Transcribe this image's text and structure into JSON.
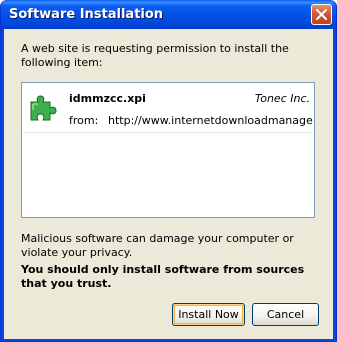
{
  "window": {
    "title": "Software Installation"
  },
  "dialog": {
    "intro_text": "A web site is requesting permission to install the following item:",
    "item": {
      "name": "idmmzcc.xpi",
      "author": "Tonec Inc.",
      "from_label": "from:",
      "from_url": "http://www.internetdownloadmanager.co",
      "icon": "puzzle-piece-icon"
    },
    "warning_text": "Malicious software can damage your computer or violate your privacy.",
    "advice_text": "You should only install software from sources that you trust.",
    "install_label": "Install Now",
    "cancel_label": "Cancel"
  },
  "colors": {
    "titlebar": "#0552e6",
    "client_background": "#ece9d8",
    "close_button": "#d2572e",
    "icon_green": "#3cb04a"
  }
}
